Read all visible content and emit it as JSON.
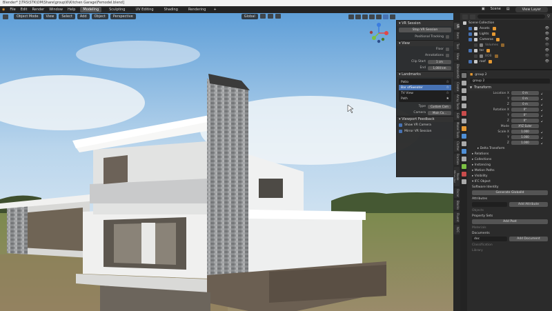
{
  "window": {
    "title": "Blender* [\\TRS\\STK\\OM\\Share\\group\\6\\Kitchen Garage\\Femodel.blend]"
  },
  "menubar": {
    "menus": [
      "File",
      "Edit",
      "Render",
      "Window",
      "Help"
    ],
    "workspaces": [
      "Modeling",
      "Sculpting",
      "UV Editing",
      "Shading",
      "Rendering"
    ],
    "active_workspace": "Modeling",
    "scene": "Scene",
    "view_layer": "View Layer"
  },
  "viewport": {
    "mode": "Object Mode",
    "menus": [
      "View",
      "Select",
      "Add",
      "Object",
      "Perspective"
    ],
    "orientation": "Global"
  },
  "vr_panel": {
    "vr_session": {
      "title": "VR Session",
      "button": "Stop VR Session",
      "positional_tracking": "Positional Tracking"
    },
    "view": {
      "title": "View",
      "floor": "Floor",
      "annotations": "Annotations",
      "clip_start_label": "Clip Start",
      "clip_start_value": "1 cm",
      "clip_end_label": "End",
      "clip_end_value": "1,000 km"
    },
    "landmarks": {
      "title": "Landmarks",
      "items": [
        "Patio",
        "Bar ofSweater",
        "TV View",
        "Path"
      ],
      "selected_index": 1,
      "type_label": "Type",
      "type_value": "Custom Cam",
      "camera_label": "Camera",
      "camera_value": "Main Ca..."
    },
    "viewport_feedback": {
      "title": "Viewport Feedback",
      "show_vr_camera": "Show VR Camera",
      "mirror_vr_session": "Mirror VR Session"
    }
  },
  "side_tabs": [
    "VR",
    "Item",
    "Tool",
    "View",
    "BlenderKit",
    "Create",
    "Array Tools",
    "Edit",
    "Model Tools",
    "Clutter",
    "Fraction",
    "Node Wrangler",
    "Oscar",
    "Blocks",
    "Fluent",
    "N2C"
  ],
  "outliner": {
    "title": "Scene Collection",
    "rows": [
      {
        "name": "Assets",
        "indent": 1,
        "icon": "collection-icon",
        "vis": true
      },
      {
        "name": "Lights",
        "indent": 1,
        "icon": "collection-icon",
        "vis": true
      },
      {
        "name": "Cameras",
        "indent": 1,
        "icon": "collection-icon",
        "vis": true
      },
      {
        "name": "Volumes",
        "indent": 2,
        "icon": "collection-icon",
        "vis": false
      },
      {
        "name": "ter",
        "indent": 1,
        "icon": "collection-icon",
        "vis": true
      },
      {
        "name": "BOB",
        "indent": 2,
        "icon": "collection-icon",
        "vis": false
      },
      {
        "name": "roof",
        "indent": 1,
        "icon": "object-icon",
        "vis": true
      }
    ]
  },
  "properties": {
    "object_path": "group 2",
    "object_name": "group 2",
    "transform": {
      "title": "Transform",
      "location_label": "Location X",
      "location": [
        "0 m",
        "0 m",
        "0 m"
      ],
      "rotation_label": "Rotation X",
      "rotation": [
        "0°",
        "0°",
        "0°"
      ],
      "mode_label": "Mode",
      "mode_value": "XYZ Euler",
      "scale_label": "Scale X",
      "scale": [
        "1.000",
        "1.000",
        "1.000"
      ],
      "axis_y": "Y",
      "axis_z": "Z"
    },
    "delta_transform": "Delta Transform",
    "collapsed": [
      "Relations",
      "Collections",
      "Instancing",
      "Motion Paths",
      "Visibility"
    ],
    "ifc_object": "IFC Object",
    "software_identity": "Software Identity",
    "generate_globalid": "Generate GlobalId",
    "attributes_label": "Attributes",
    "add_attribute": "Add Attribute",
    "objects_label": "Objects",
    "property_sets": "Property Sets",
    "add_pset": "Add Pset",
    "materials_label": "Materials",
    "documents_label": "Documents",
    "documents_value": "doc",
    "add_document": "Add Document",
    "classification": "Classification",
    "library_label": "Library"
  },
  "colors": {
    "accent": "#4772b3",
    "orange": "#e59933",
    "panel": "#2b2b2b"
  }
}
